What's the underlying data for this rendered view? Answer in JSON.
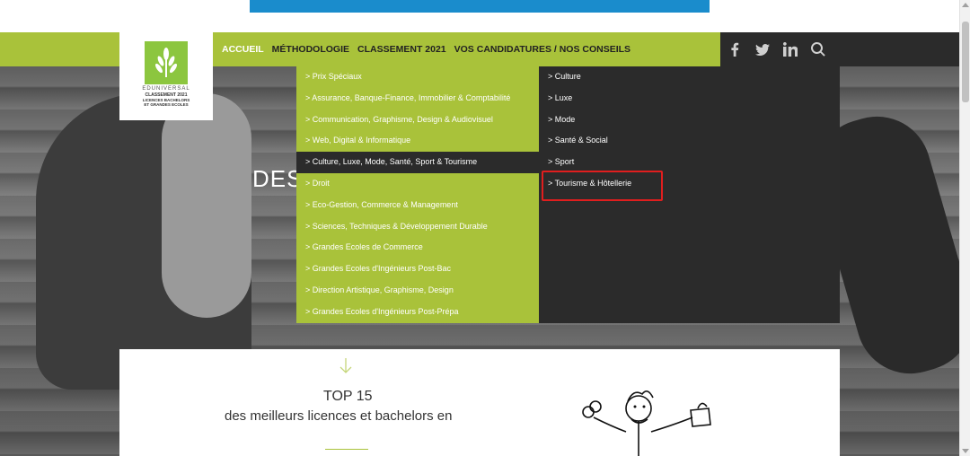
{
  "logo": {
    "line1": "EDUNIVERSAL",
    "line2": "CLASSEMENT 2021",
    "line3": "LICENCES BACHELORS",
    "line4": "ET GRANDES ECOLES"
  },
  "nav": {
    "items": [
      {
        "label": "ACCUEIL",
        "active": true
      },
      {
        "label": "MÉTHODOLOGIE",
        "active": false
      },
      {
        "label": "CLASSEMENT 2021",
        "active": false
      },
      {
        "label": "VOS CANDIDATURES / NOS CONSEILS",
        "active": false
      }
    ]
  },
  "social": {
    "icons": [
      "facebook-icon",
      "twitter-icon",
      "linkedin-icon",
      "search-icon"
    ]
  },
  "menu": {
    "left": [
      "> Prix Spéciaux",
      "> Assurance, Banque-Finance, Immobilier & Comptabilité",
      "> Communication, Graphisme, Design & Audiovisuel",
      "> Web, Digital & Informatique",
      "> Culture, Luxe, Mode, Santé, Sport & Tourisme",
      "> Droit",
      "> Eco-Gestion, Commerce & Management",
      "> Sciences, Techniques & Développement Durable",
      "> Grandes Ecoles de Commerce",
      "> Grandes Ecoles d'Ingénieurs Post-Bac",
      "> Direction Artistique, Graphisme, Design",
      "> Grandes Ecoles d'Ingénieurs Post-Prépa"
    ],
    "left_selected_index": 4,
    "right": [
      "> Culture",
      "> Luxe",
      "> Mode",
      "> Santé & Social",
      "> Sport",
      "> Tourisme & Hôtellerie"
    ]
  },
  "hero": {
    "title": "DES"
  },
  "content": {
    "top": "TOP 15",
    "sub": "des meilleurs licences et bachelors en"
  },
  "colors": {
    "brand_green": "#a9c23a",
    "dark": "#2b2b2b",
    "accent_blue": "#1a8ccc",
    "highlight_red": "#e01e1e"
  }
}
